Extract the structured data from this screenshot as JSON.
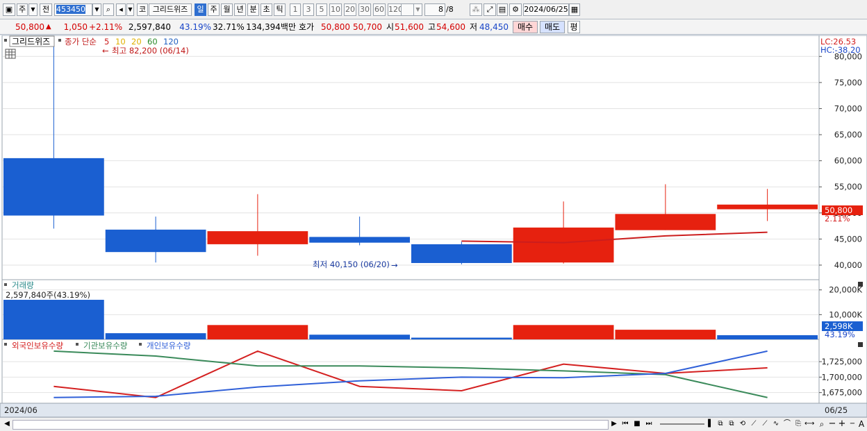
{
  "toolbar": {
    "period_short": "주",
    "all_label": "전",
    "code": "453450",
    "code_kind": "코",
    "stock_name": "그리드위즈",
    "period_tabs": [
      "일",
      "주",
      "월",
      "년",
      "분",
      "초",
      "틱"
    ],
    "minute_tabs": [
      "1",
      "3",
      "5",
      "10",
      "20",
      "30",
      "60",
      "120"
    ],
    "page_count": "8",
    "page_total": "/8",
    "date": "2024/06/25"
  },
  "quote": {
    "price": "50,800",
    "arrow": "▲",
    "change": "1,050",
    "change_pct": "+2.11%",
    "volume": "2,597,840",
    "vol_ratio": "43.19%",
    "turnover": "32.71%",
    "amount": "134,394백만",
    "bid_label": "호가",
    "ask_price": "50,800",
    "bid_price": "50,700",
    "open_label": "시",
    "open": "51,600",
    "high_label": "고",
    "high": "54,600",
    "low_label": "저",
    "low": "48,450",
    "buy_label": "매수",
    "sell_label": "매도",
    "avg_label": "평"
  },
  "colors": {
    "up": "#e6210f",
    "down": "#1a5fd1",
    "grid": "#e2e2e2",
    "ma5": "#cc1d1d"
  },
  "chart_data": [
    {
      "type": "candlestick",
      "title": "그리드위즈",
      "legend": {
        "label": "종가 단순",
        "periods": [
          "5",
          "10",
          "20",
          "60",
          "120"
        ],
        "period_colors": [
          "#cc1d1d",
          "#e0b000",
          "#e0b000",
          "#2a8a2a",
          "#2060c0"
        ]
      },
      "x": [
        "1",
        "2",
        "3",
        "4",
        "5",
        "6",
        "7",
        "8"
      ],
      "ohlc": [
        [
          60500,
          82200,
          47000,
          49500
        ],
        [
          46800,
          49300,
          40500,
          42500
        ],
        [
          44000,
          53600,
          41800,
          46500
        ],
        [
          45400,
          49300,
          43800,
          44300
        ],
        [
          44000,
          44500,
          40150,
          40400
        ],
        [
          40500,
          52200,
          40300,
          47200
        ],
        [
          46700,
          55500,
          46700,
          49800
        ],
        [
          50700,
          54600,
          48450,
          51600
        ]
      ],
      "ma5": [
        null,
        null,
        null,
        null,
        44600,
        44300,
        45600,
        46300
      ],
      "ylim": [
        38000,
        83500
      ],
      "yticks": [
        40000,
        45000,
        50000,
        55000,
        60000,
        65000,
        70000,
        75000,
        80000
      ],
      "ytick_labels": [
        "40,000",
        "45,000",
        "50,000",
        "55,000",
        "60,000",
        "65,000",
        "70,000",
        "75,000",
        "80,000"
      ],
      "high_annotation": "최고 82,200 (06/14)",
      "low_annotation": "최저 40,150 (06/20)",
      "lc_label": "LC:26.53",
      "hc_label": "HC:-38.20",
      "price_tag": "50,800",
      "pct_tag": "2.11%"
    },
    {
      "type": "bar",
      "title": "거래량",
      "readout": "2,597,840주(43.19%)",
      "values": [
        16000,
        2500,
        5800,
        1900,
        700,
        5800,
        3900,
        1700
      ],
      "direction": [
        "down",
        "down",
        "up",
        "down",
        "down",
        "up",
        "up",
        "down"
      ],
      "ylim": [
        0,
        23000
      ],
      "yticks": [
        10000,
        20000
      ],
      "ytick_labels": [
        "10,000K",
        "20,000K"
      ],
      "tag": "2,598K",
      "pct_tag": "43.19%"
    },
    {
      "type": "line",
      "series": [
        {
          "name": "외국인보유수량",
          "color": "#d42020",
          "values": [
            1685000,
            1667000,
            1742000,
            1685000,
            1678000,
            1721000,
            1706000,
            1715000
          ]
        },
        {
          "name": "기관보유수량",
          "color": "#3a8a5a",
          "values": [
            1742000,
            1734000,
            1718000,
            1718000,
            1715000,
            1710000,
            1704000,
            1667000
          ]
        },
        {
          "name": "개인보유수량",
          "color": "#3060d8",
          "values": [
            1667000,
            1669000,
            1684000,
            1694000,
            1700000,
            1699000,
            1706000,
            1742000
          ]
        }
      ],
      "ylim": [
        1660000,
        1752000
      ],
      "yticks": [
        1675000,
        1700000,
        1725000
      ],
      "ytick_labels": [
        "1,675,000",
        "1,700,000",
        "1,725,000"
      ]
    }
  ],
  "xaxis": {
    "left_label": "2024/06",
    "right_label": "06/25"
  }
}
